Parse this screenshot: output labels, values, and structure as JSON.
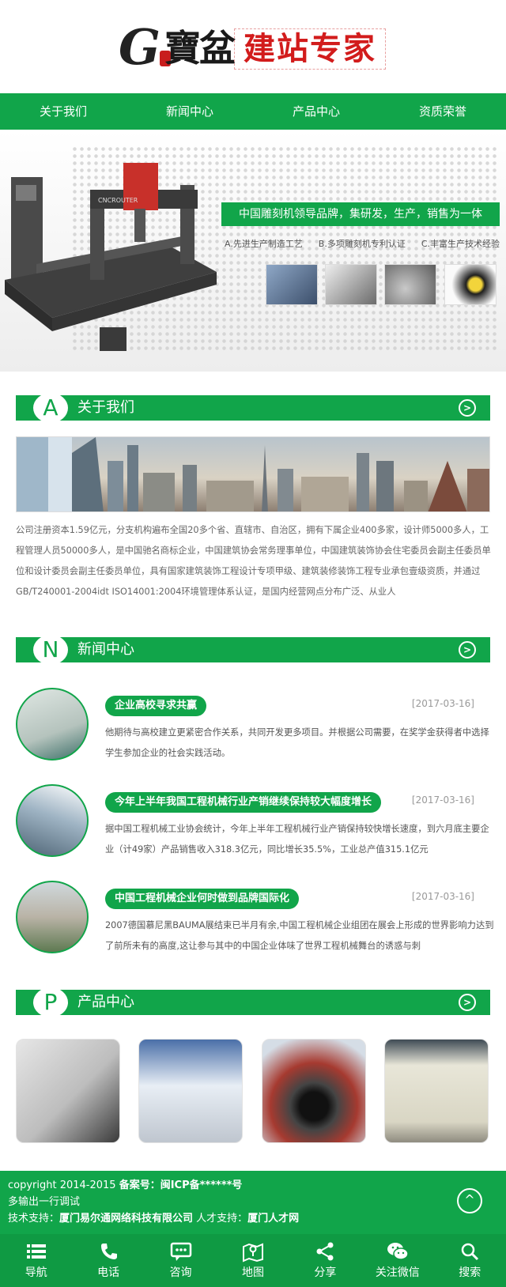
{
  "header": {
    "logo_mark": "G",
    "logo_cn": "寶盆",
    "logo_tagline": "建站专家"
  },
  "nav": [
    {
      "label": "关于我们"
    },
    {
      "label": "新闻中心"
    },
    {
      "label": "产品中心"
    },
    {
      "label": "资质荣誉"
    }
  ],
  "banner": {
    "slogan": "中国雕刻机领导品牌，集研发，生产，销售为一体",
    "points": [
      "A.先进生产制造工艺",
      "B.多项雕刻机专利认证",
      "C.丰富生产技术经验"
    ],
    "machine_brand": "CNCROUTER"
  },
  "about": {
    "letter": "A",
    "title": "关于我们",
    "more_icon": "circle-chevron-right",
    "text": "公司注册资本1.59亿元，分支机构遍布全国20多个省、直辖市、自治区，拥有下属企业400多家，设计师5000多人，工程管理人员50000多人，是中国驰名商标企业，中国建筑协会常务理事单位，中国建筑装饰协会住宅委员会副主任委员单位和设计委员会副主任委员单位，具有国家建筑装饰工程设计专项甲级、建筑装修装饰工程专业承包壹级资质，并通过GB/T240001-2004idt ISO14001:2004环境管理体系认证，是国内经营网点分布广泛、从业人"
  },
  "news": {
    "letter": "N",
    "title": "新闻中心",
    "items": [
      {
        "title": "企业高校寻求共赢",
        "date": "[2017-03-16]",
        "desc": "他期待与高校建立更紧密合作关系，共同开发更多项目。并根据公司需要，在奖学金获得者中选择学生参加企业的社会实践活动。"
      },
      {
        "title": "今年上半年我国工程机械行业产销继续保持较大幅度增长",
        "date": "[2017-03-16]",
        "desc": "据中国工程机械工业协会统计，今年上半年工程机械行业产销保持较快增长速度，到六月底主要企业（计49家）产品销售收入318.3亿元，同比增长35.5%，工业总产值315.1亿元"
      },
      {
        "title": "中国工程机械企业何时做到品牌国际化",
        "date": "[2017-03-16]",
        "desc": "2007德国慕尼黑BAUMA展结束已半月有余,中国工程机械企业组团在展会上形成的世界影响力达到了前所未有的高度,这让参与其中的中国企业体味了世界工程机械舞台的诱惑与刺"
      }
    ]
  },
  "products": {
    "letter": "P",
    "title": "产品中心"
  },
  "footer": {
    "line1_prefix": "copyright 2014-2015 ",
    "line1_bold": "备案号：闽ICP备******号",
    "line2": "多输出一行调试",
    "line3_prefix": "技术支持：",
    "line3_company": "厦门易尔通网络科技有限公司",
    "line3_mid": " 人才支持：",
    "line3_talent": "厦门人才网",
    "totop": "^"
  },
  "bottombar": [
    {
      "label": "导航",
      "icon": "list-icon"
    },
    {
      "label": "电话",
      "icon": "phone-icon"
    },
    {
      "label": "咨询",
      "icon": "chat-icon"
    },
    {
      "label": "地图",
      "icon": "map-icon"
    },
    {
      "label": "分享",
      "icon": "share-icon"
    },
    {
      "label": "关注微信",
      "icon": "wechat-icon"
    },
    {
      "label": "搜索",
      "icon": "search-icon"
    }
  ],
  "colors": {
    "brand_green": "#11a54a",
    "accent_red": "#d21c1c"
  }
}
